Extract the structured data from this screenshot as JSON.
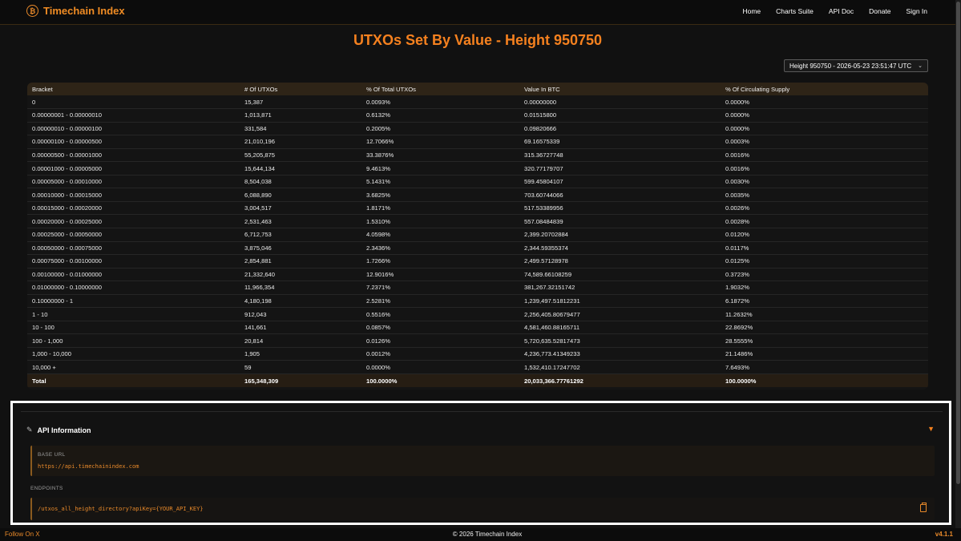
{
  "header": {
    "brand": "Timechain Index",
    "logo_glyph": "₿",
    "nav": [
      "Home",
      "Charts Suite",
      "API Doc",
      "Donate",
      "Sign In"
    ]
  },
  "page_title": "UTXOs Set By Value - Height 950750",
  "height_select": {
    "selected": "Height 950750 - 2026-05-23 23:51:47 UTC"
  },
  "table": {
    "columns": [
      "Bracket",
      "# Of UTXOs",
      "% Of Total UTXOs",
      "Value In BTC",
      "% Of Circulating Supply"
    ],
    "rows": [
      [
        "0",
        "15,387",
        "0.0093%",
        "0.00000000",
        "0.0000%"
      ],
      [
        "0.00000001 - 0.00000010",
        "1,013,871",
        "0.6132%",
        "0.01515800",
        "0.0000%"
      ],
      [
        "0.00000010 - 0.00000100",
        "331,584",
        "0.2005%",
        "0.09820666",
        "0.0000%"
      ],
      [
        "0.00000100 - 0.00000500",
        "21,010,196",
        "12.7066%",
        "69.16575339",
        "0.0003%"
      ],
      [
        "0.00000500 - 0.00001000",
        "55,205,875",
        "33.3876%",
        "315.36727748",
        "0.0016%"
      ],
      [
        "0.00001000 - 0.00005000",
        "15,644,134",
        "9.4613%",
        "320.77179707",
        "0.0016%"
      ],
      [
        "0.00005000 - 0.00010000",
        "8,504,038",
        "5.1431%",
        "599.45804107",
        "0.0030%"
      ],
      [
        "0.00010000 - 0.00015000",
        "6,088,890",
        "3.6825%",
        "703.60744066",
        "0.0035%"
      ],
      [
        "0.00015000 - 0.00020000",
        "3,004,517",
        "1.8171%",
        "517.53389956",
        "0.0026%"
      ],
      [
        "0.00020000 - 0.00025000",
        "2,531,463",
        "1.5310%",
        "557.08484839",
        "0.0028%"
      ],
      [
        "0.00025000 - 0.00050000",
        "6,712,753",
        "4.0598%",
        "2,399.20702884",
        "0.0120%"
      ],
      [
        "0.00050000 - 0.00075000",
        "3,875,046",
        "2.3436%",
        "2,344.59355374",
        "0.0117%"
      ],
      [
        "0.00075000 - 0.00100000",
        "2,854,881",
        "1.7266%",
        "2,499.57128978",
        "0.0125%"
      ],
      [
        "0.00100000 - 0.01000000",
        "21,332,640",
        "12.9016%",
        "74,589.66108259",
        "0.3723%"
      ],
      [
        "0.01000000 - 0.10000000",
        "11,966,354",
        "7.2371%",
        "381,267.32151742",
        "1.9032%"
      ],
      [
        "0.10000000 - 1",
        "4,180,198",
        "2.5281%",
        "1,239,497.51812231",
        "6.1872%"
      ],
      [
        "1 - 10",
        "912,043",
        "0.5516%",
        "2,256,405.80679477",
        "11.2632%"
      ],
      [
        "10 - 100",
        "141,661",
        "0.0857%",
        "4,581,460.88165711",
        "22.8692%"
      ],
      [
        "100 - 1,000",
        "20,814",
        "0.0126%",
        "5,720,635.52817473",
        "28.5555%"
      ],
      [
        "1,000 - 10,000",
        "1,905",
        "0.0012%",
        "4,236,773.41349233",
        "21.1486%"
      ],
      [
        "10,000 +",
        "59",
        "0.0000%",
        "1,532,410.17247702",
        "7.6493%"
      ]
    ],
    "total": [
      "Total",
      "165,348,309",
      "100.0000%",
      "20,033,366.77761292",
      "100.0000%"
    ]
  },
  "api": {
    "title": "API Information",
    "base_url_label": "BASE URL",
    "base_url": "https://api.timechainindex.com",
    "endpoints_label": "ENDPOINTS",
    "endpoint": "/utxos_all_height_directory?apiKey={YOUR_API_KEY}"
  },
  "footer": {
    "follow": "Follow On X",
    "copyright": "© 2026 Timechain Index",
    "version": "v4.1.1"
  },
  "colors": {
    "accent": "#f5811f",
    "background": "#111111",
    "header_row": "#2e2417"
  }
}
